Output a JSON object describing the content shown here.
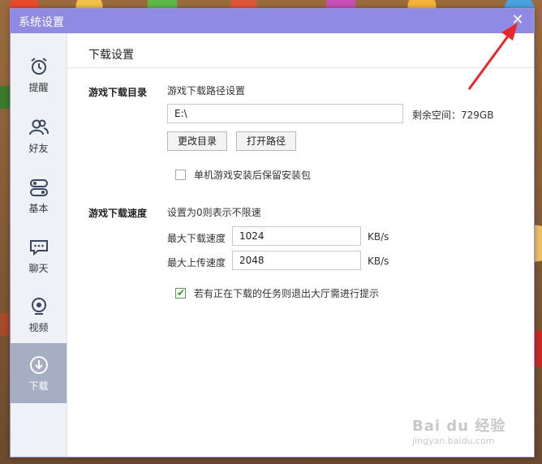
{
  "window": {
    "title": "系统设置",
    "close_glyph": "✕"
  },
  "sidebar": {
    "items": [
      {
        "label": "提醒",
        "icon": "alarm-clock-icon"
      },
      {
        "label": "好友",
        "icon": "friends-icon"
      },
      {
        "label": "基本",
        "icon": "toggle-icon"
      },
      {
        "label": "聊天",
        "icon": "chat-icon"
      },
      {
        "label": "视频",
        "icon": "webcam-icon"
      },
      {
        "label": "下载",
        "icon": "download-icon",
        "active": true
      }
    ]
  },
  "main": {
    "title": "下载设置",
    "dir_section": {
      "heading": "游戏下载目录",
      "sub_label": "游戏下载路径设置",
      "path_value": "E:\\",
      "free_space": "剩余空间：729GB",
      "change_dir_button": "更改目录",
      "open_path_button": "打开路径",
      "keep_package_checkbox": {
        "label": "单机游戏安装后保留安装包",
        "checked": false
      }
    },
    "speed_section": {
      "heading": "游戏下载速度",
      "hint": "设置为0则表示不限速",
      "max_download_label": "最大下载速度",
      "max_download_value": "1024",
      "max_upload_label": "最大上传速度",
      "max_upload_value": "2048",
      "unit": "KB/s",
      "prompt_checkbox": {
        "label": "若有正在下载的任务则退出大厅需进行提示",
        "checked": true
      }
    }
  },
  "watermark": {
    "text": "Bai du 经验",
    "url": "jingyan.baidu.com"
  },
  "colors": {
    "titlebar": "#8f8ae4",
    "sidebar_active": "#a6aec4",
    "arrow": "#e8262b"
  }
}
